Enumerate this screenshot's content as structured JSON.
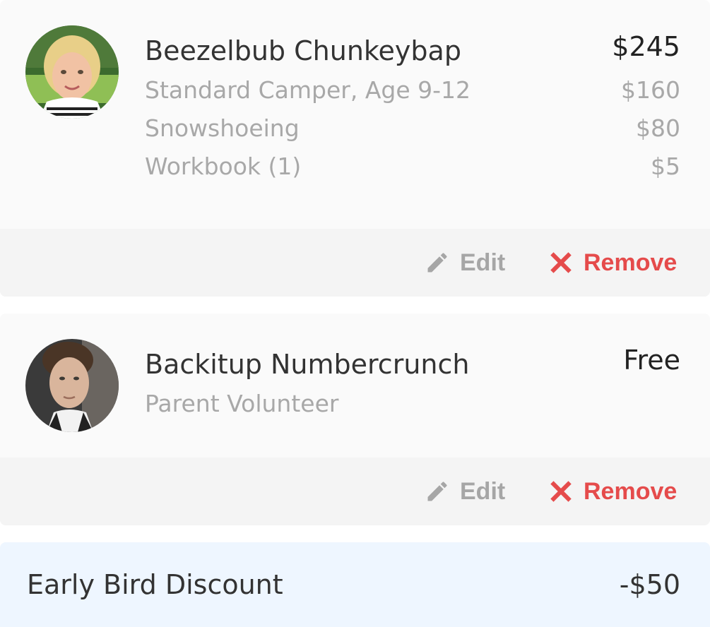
{
  "registrants": [
    {
      "name": "Beezelbub Chunkeybap",
      "total": "$245",
      "avatar_icon": "child-portrait-avatar",
      "line_items": [
        {
          "label": "Standard Camper, Age 9-12",
          "price": "$160"
        },
        {
          "label": "Snowshoeing",
          "price": "$80"
        },
        {
          "label": "Workbook (1)",
          "price": "$5"
        }
      ],
      "edit_label": "Edit",
      "remove_label": "Remove"
    },
    {
      "name": "Backitup Numbercrunch",
      "total": "Free",
      "avatar_icon": "adult-portrait-avatar",
      "line_items": [
        {
          "label": "Parent Volunteer",
          "price": ""
        }
      ],
      "edit_label": "Edit",
      "remove_label": "Remove"
    }
  ],
  "discount": {
    "label": "Early Bird Discount",
    "amount": "-$50"
  },
  "colors": {
    "card_bg": "#fafafa",
    "actions_bg": "#f4f4f4",
    "remove_red": "#e54b4b",
    "muted_gray": "#a8a8a8",
    "discount_bg": "#eef6ff"
  },
  "icons": {
    "edit": "pencil-icon",
    "remove": "x-close-icon"
  }
}
